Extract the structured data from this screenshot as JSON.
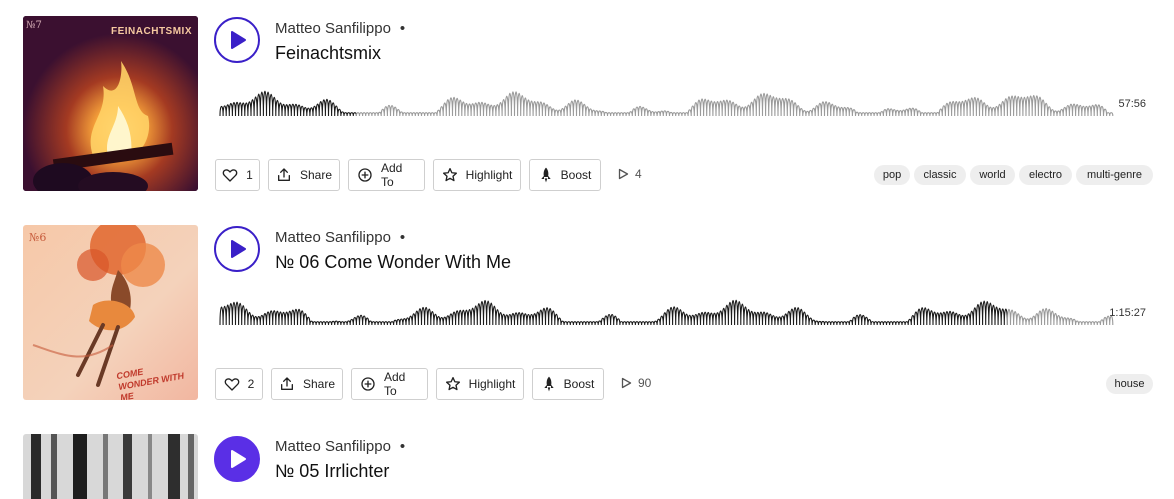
{
  "tracks": [
    {
      "artist": "Matteo Sanfilippo",
      "title": "Feinachtsmix",
      "duration": "57:56",
      "likes": "1",
      "actions": {
        "share": "Share",
        "add": "Add To",
        "highlight": "Highlight",
        "boost": "Boost"
      },
      "plays": "4",
      "tags": [
        "pop",
        "classic",
        "world",
        "electro",
        "multi-genre"
      ],
      "art_text": "FEINACHTSMIX",
      "art_number": "№7"
    },
    {
      "artist": "Matteo Sanfilippo",
      "title": "№ 06 Come Wonder With Me",
      "duration": "1:15:27",
      "likes": "2",
      "actions": {
        "share": "Share",
        "add": "Add To",
        "highlight": "Highlight",
        "boost": "Boost"
      },
      "plays": "90",
      "tags": [
        "house"
      ],
      "art_text": "COME WONDER WITH ME",
      "art_number": "№6"
    },
    {
      "artist": "Matteo Sanfilippo",
      "title": "№ 05 Irrlichter"
    }
  ],
  "colors": {
    "accent": "#5a2fe6",
    "play_border": "#3a20c8",
    "tag_bg": "#eeeeee"
  }
}
